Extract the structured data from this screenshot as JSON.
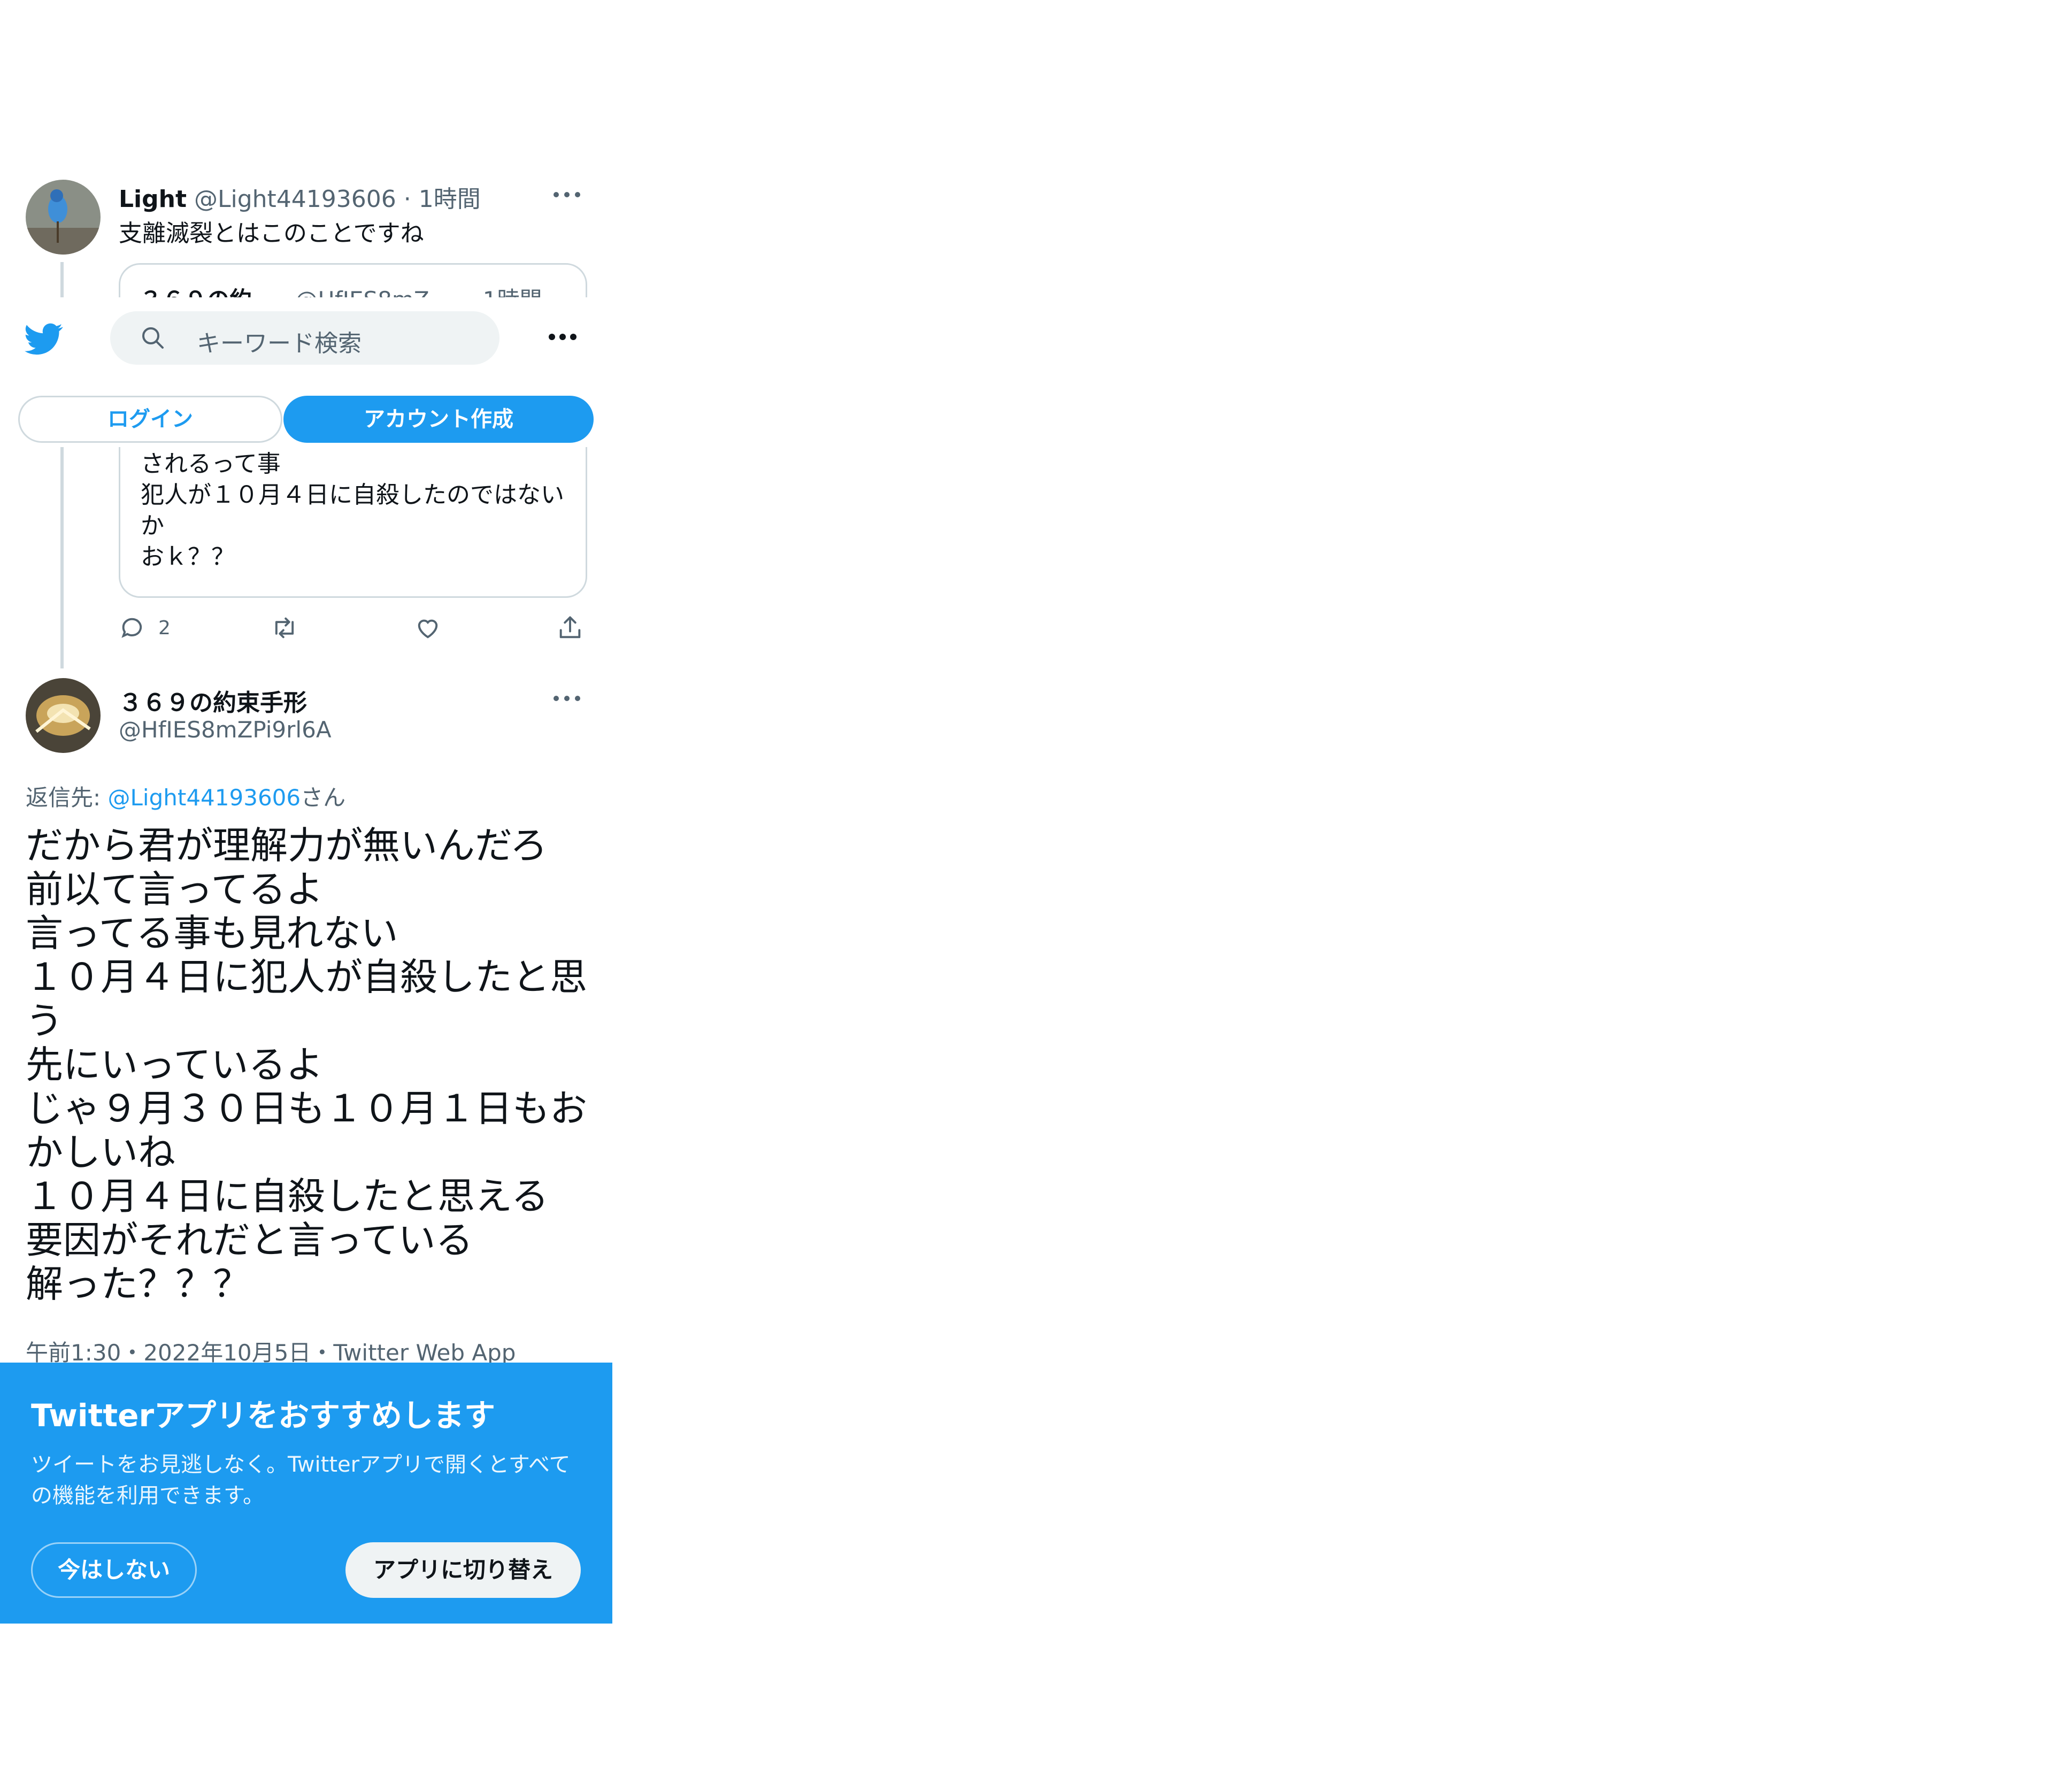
{
  "header": {
    "search_placeholder": "キーワード検索",
    "login_label": "ログイン",
    "signup_label": "アカウント作成"
  },
  "reply_tweet": {
    "display_name": "Light",
    "handle": "@Light44193606",
    "separator": "·",
    "time": "1時間",
    "text": "支離滅裂とはこのことですね",
    "quote": {
      "display_name": "３６９の約...",
      "handle": "@HfIES8mZ...",
      "time": "· 1時間",
      "text_lines": [
        "されるって事",
        "犯人が１０月４日に自殺したのではない",
        "か",
        "おｋ？？"
      ]
    },
    "actions": {
      "reply_count": "2"
    }
  },
  "main_tweet": {
    "display_name": "３６９の約束手形",
    "handle": "@HfIES8mZPi9rl6A",
    "reply_to_label": "返信先: ",
    "reply_to_handle": "@Light44193606",
    "reply_to_suffix": "さん",
    "text": "だから君が理解力が無いんだろ\n前以て言ってるよ\n言ってる事も見れない\n１０月４日に犯人が自殺したと思\nう\n先にいっているよ\nじゃ９月３０日も１０月１日もお\nかしいね\n１０月４日に自殺したと思える\n要因がそれだと言っている\n解った？？？",
    "timestamp": "午前1:30・2022年10月5日・Twitter Web App"
  },
  "app_banner": {
    "title": "Twitterアプリをおすすめします",
    "body": "ツイートをお見逃しなく。Twitterアプリで開くとすべての機能を利用できます。",
    "not_now_label": "今はしない",
    "switch_label": "アプリに切り替え"
  },
  "colors": {
    "brand_blue": "#1d9bf0",
    "text_primary": "#0f1419",
    "text_secondary": "#536471",
    "border": "#cfd9de"
  },
  "icons": [
    "twitter-bird-icon",
    "search-icon",
    "more-icon",
    "reply-icon",
    "retweet-icon",
    "like-icon",
    "share-icon"
  ]
}
